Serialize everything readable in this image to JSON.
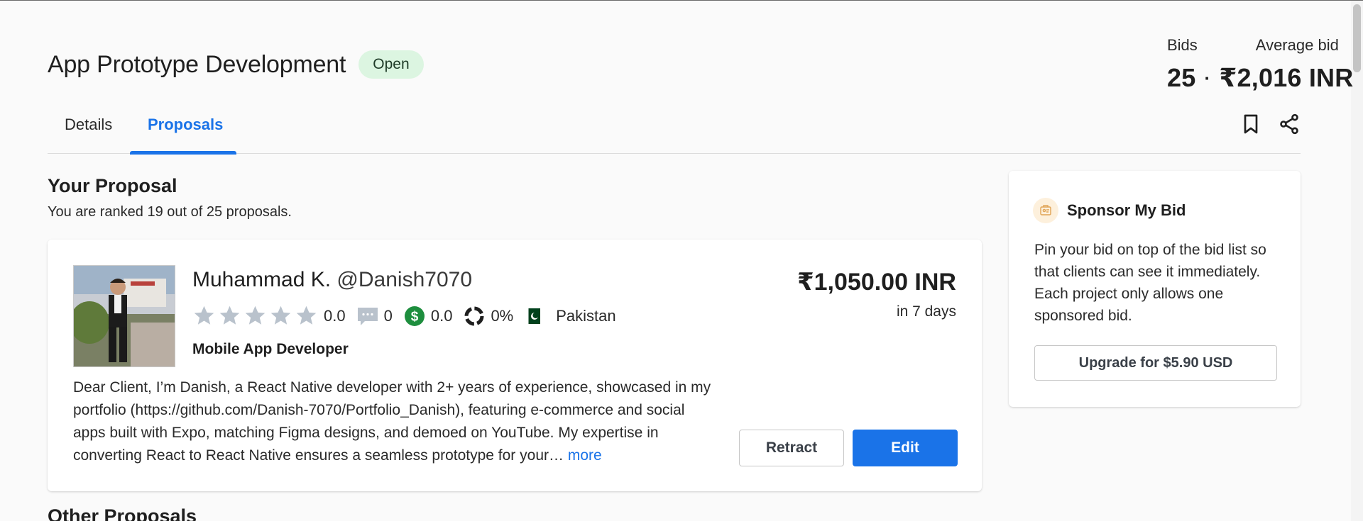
{
  "project": {
    "title": "App Prototype Development",
    "status": "Open"
  },
  "stats": {
    "bids_label": "Bids",
    "avg_label": "Average bid",
    "bids_value": "25",
    "separator": "·",
    "avg_value": "₹2,016 INR"
  },
  "tabs": {
    "details": "Details",
    "proposals": "Proposals",
    "active": "Proposals"
  },
  "icons": {
    "bookmark": "bookmark-icon",
    "share": "share-icon",
    "star": "star-icon",
    "reviews": "chat-bubble-icon",
    "earnings": "dollar-circle-icon",
    "completion": "progress-ring-icon",
    "flag": "pakistan-flag-icon",
    "sponsor": "badge-icon"
  },
  "your_proposal": {
    "title": "Your Proposal",
    "rank_text": "You are ranked 19 out of 25 proposals."
  },
  "proposal": {
    "name": "Muhammad K.",
    "handle": "@Danish7070",
    "rating": "0.0",
    "star_count_filled": 0,
    "reviews": "0",
    "earnings_score": "0.0",
    "completion": "0%",
    "country": "Pakistan",
    "role": "Mobile App Developer",
    "text": "Dear Client, I’m Danish, a React Native developer with 2+ years of experience, showcased in my portfolio (https://github.com/Danish-7070/Portfolio_Danish), featuring e-commerce and social apps built with Expo, matching Figma designs, and demoed on YouTube. My expertise in converting React to React Native ensures a seamless prototype for your…",
    "more_label": "more",
    "amount": "₹1,050.00 INR",
    "delivery": "in 7 days",
    "retract_label": "Retract",
    "edit_label": "Edit"
  },
  "sponsor": {
    "title": "Sponsor My Bid",
    "description": "Pin your bid on top of the bid list so that clients can see it immediately. Each project only allows one sponsored bid.",
    "button_label": "Upgrade for $5.90 USD"
  },
  "other_proposals": {
    "title": "Other Proposals"
  },
  "colors": {
    "accent": "#1a73e8",
    "badge_bg": "#dcf5e1",
    "star_empty": "#b9c2cc",
    "earnings_green": "#1e8e3e"
  }
}
